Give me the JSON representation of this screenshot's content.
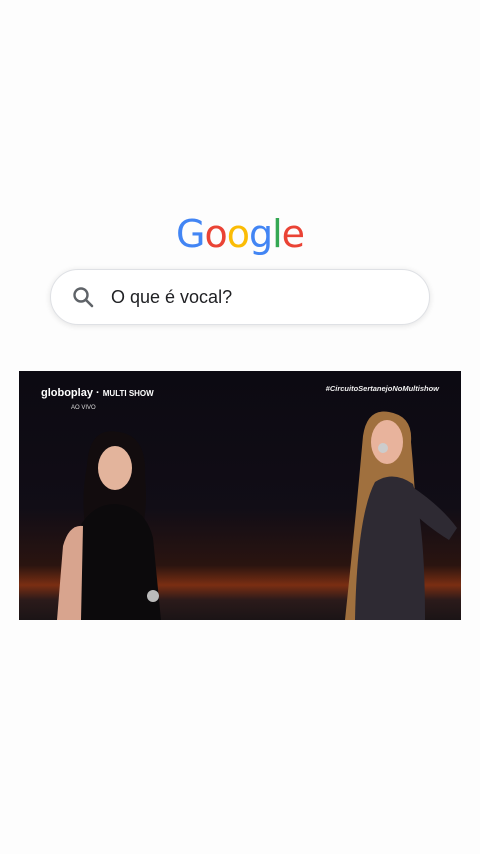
{
  "logo": {
    "letters": [
      {
        "ch": "G",
        "color": "#4285F4"
      },
      {
        "ch": "o",
        "color": "#EA4335"
      },
      {
        "ch": "o",
        "color": "#FBBC05"
      },
      {
        "ch": "g",
        "color": "#4285F4"
      },
      {
        "ch": "l",
        "color": "#34A853"
      },
      {
        "ch": "e",
        "color": "#EA4335"
      }
    ]
  },
  "search": {
    "query": "O que é vocal?",
    "icon": "search-icon"
  },
  "video": {
    "brand_left": "globoplay",
    "brand_sep": "·",
    "brand_right": "MULTI SHOW",
    "live_label": "AO VIVO",
    "hashtag": "#CircuitoSertanejoNoMultishow"
  }
}
